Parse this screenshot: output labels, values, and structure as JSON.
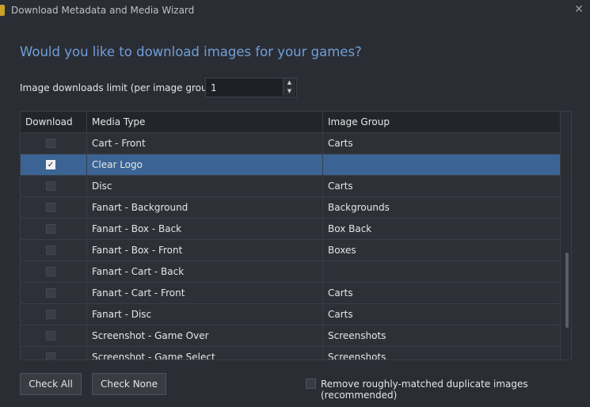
{
  "window": {
    "title": "Download Metadata and Media Wizard",
    "close_glyph": "✕"
  },
  "heading": "Would you like to download images for your games?",
  "limit": {
    "label": "Image downloads limit (per image group):",
    "value": "1",
    "up_glyph": "▲",
    "down_glyph": "▼"
  },
  "grid": {
    "columns": [
      "Download",
      "Media Type",
      "Image Group"
    ],
    "rows": [
      {
        "checked": false,
        "media_type": "Cart - Front",
        "image_group": "Carts"
      },
      {
        "checked": true,
        "media_type": "Clear Logo",
        "image_group": "",
        "selected": true
      },
      {
        "checked": false,
        "media_type": "Disc",
        "image_group": "Carts"
      },
      {
        "checked": false,
        "media_type": "Fanart - Background",
        "image_group": "Backgrounds"
      },
      {
        "checked": false,
        "media_type": "Fanart - Box - Back",
        "image_group": "Box Back"
      },
      {
        "checked": false,
        "media_type": "Fanart - Box - Front",
        "image_group": "Boxes"
      },
      {
        "checked": false,
        "media_type": "Fanart - Cart - Back",
        "image_group": ""
      },
      {
        "checked": false,
        "media_type": "Fanart - Cart - Front",
        "image_group": "Carts"
      },
      {
        "checked": false,
        "media_type": "Fanart - Disc",
        "image_group": "Carts"
      },
      {
        "checked": false,
        "media_type": "Screenshot - Game Over",
        "image_group": "Screenshots"
      },
      {
        "checked": false,
        "media_type": "Screenshot - Game Select",
        "image_group": "Screenshots"
      }
    ]
  },
  "buttons": {
    "check_all": "Check All",
    "check_none": "Check None"
  },
  "duplicates": {
    "checked": false,
    "label": "Remove roughly-matched duplicate images (recommended)"
  },
  "colors": {
    "accent_heading": "#6f9fd8",
    "selected_row": "#3b6494",
    "background": "#2b2d35"
  },
  "icons": {
    "app": "app-icon",
    "close": "close-icon",
    "check": "✓"
  }
}
